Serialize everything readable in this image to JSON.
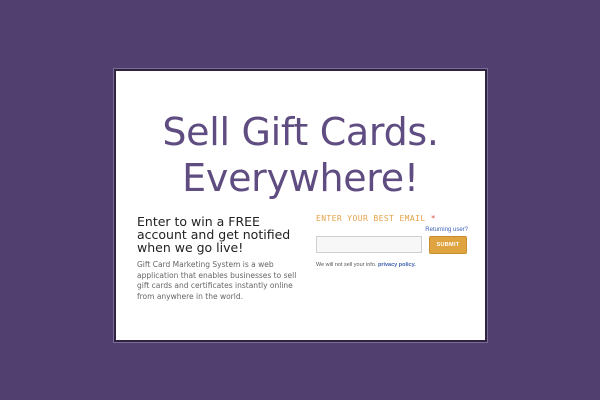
{
  "headline": {
    "line1": "Sell Gift Cards.",
    "line2": "Everywhere!"
  },
  "promo": {
    "heading": "Enter to win a FREE account and get notified when we go live!",
    "description": "Gift Card Marketing System is a web application that enables businesses to sell gift cards and certificates  instantly online from anywhere in the world."
  },
  "signup": {
    "email_label": "ENTER YOUR BEST EMAIL",
    "required_marker": "*",
    "returning_user": "Returning user?",
    "email_value": "",
    "submit_label": "SUBMIT",
    "privacy_text": "We will not sell your info.",
    "privacy_link": "privacy policy."
  },
  "colors": {
    "background": "#51406f",
    "headline": "#5f4d82",
    "label_accent": "#e4a248",
    "button": "#dfa33f",
    "link": "#3f5fb0"
  }
}
